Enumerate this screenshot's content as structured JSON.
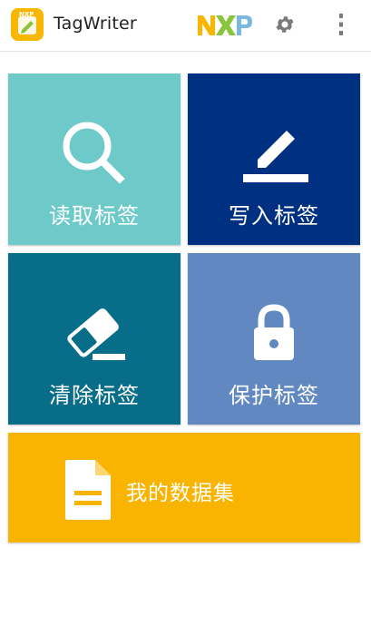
{
  "app_bar": {
    "title": "TagWriter",
    "logo_icon": "tagwriter-logo-icon",
    "brand_icon": "nxp-logo",
    "settings_icon": "gear-icon",
    "overflow_icon": "more-vert-icon"
  },
  "tiles": [
    {
      "id": "read",
      "label": "读取标签",
      "icon": "search-icon",
      "color": "#6ec9c9"
    },
    {
      "id": "write",
      "label": "写入标签",
      "icon": "pencil-icon",
      "color": "#003082"
    },
    {
      "id": "erase",
      "label": "清除标签",
      "icon": "eraser-icon",
      "color": "#086d89"
    },
    {
      "id": "protect",
      "label": "保护标签",
      "icon": "lock-icon",
      "color": "#6188c0"
    },
    {
      "id": "dataset",
      "label": "我的数据集",
      "icon": "document-icon",
      "color": "#f8b400"
    }
  ],
  "colors": {
    "nxp_n": "#f7b600",
    "nxp_x": "#8ac53e",
    "nxp_p": "#7bb8e0",
    "icon_gray": "#7a7a7a"
  }
}
